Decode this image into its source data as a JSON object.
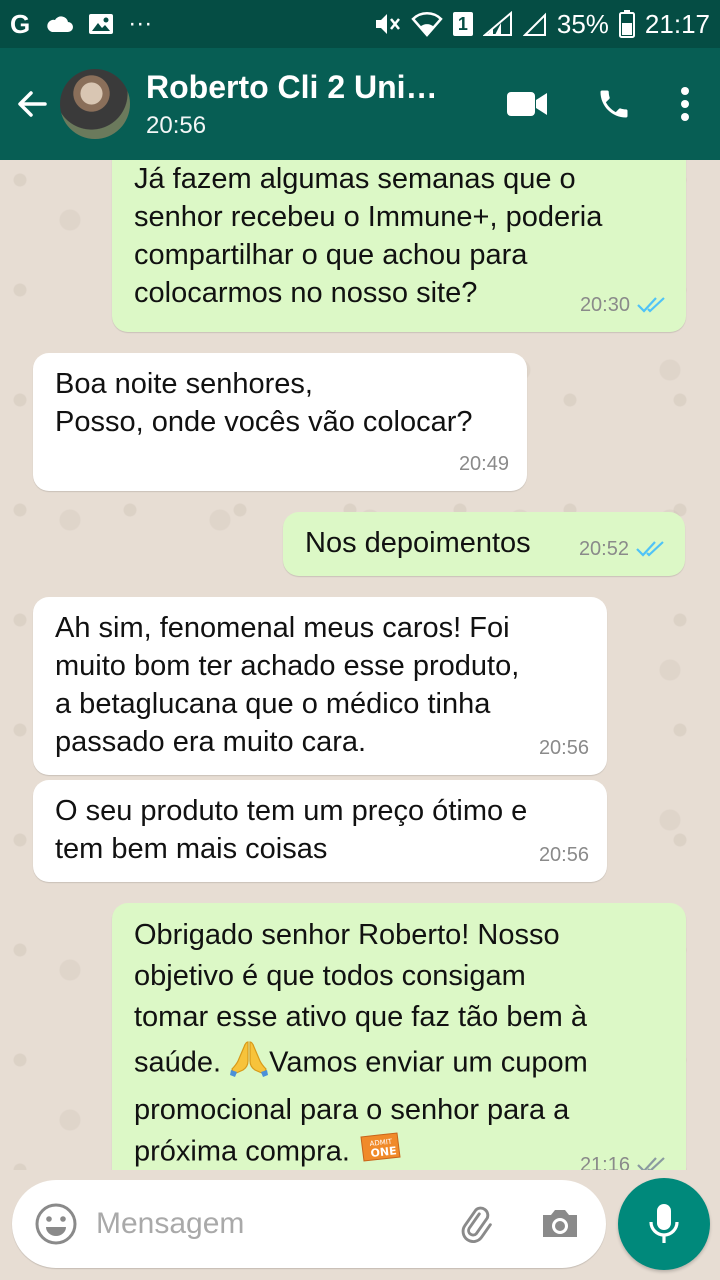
{
  "status_bar": {
    "carrier_glyph": "G",
    "battery": "35%",
    "time": "21:17",
    "sim_badge": "1",
    "dots": "···"
  },
  "header": {
    "title": "Roberto Cli 2 Uni…",
    "subtitle": "20:56"
  },
  "messages": [
    {
      "id": "m1",
      "direction": "out",
      "text": "Já fazem algumas semanas que o\nsenhor recebeu o Immune+, poderia\ncompartilhar o que achou para\ncolocarmos no nosso site?",
      "time": "20:30",
      "status": "read"
    },
    {
      "id": "m2",
      "direction": "in",
      "text": "Boa noite senhores,\nPosso, onde vocês vão colocar?",
      "time": "20:49"
    },
    {
      "id": "m3",
      "direction": "out",
      "text": "Nos depoimentos",
      "time": "20:52",
      "status": "read"
    },
    {
      "id": "m4",
      "direction": "in",
      "text": "Ah sim, fenomenal meus caros! Foi\nmuito bom ter achado esse produto,\na betaglucana que o médico tinha\npassado era muito cara.",
      "time": "20:56"
    },
    {
      "id": "m5",
      "direction": "in",
      "text": "O seu produto tem um preço ótimo e\ntem bem mais coisas",
      "time": "20:56"
    },
    {
      "id": "m6",
      "direction": "out",
      "text_parts": [
        "Obrigado senhor Roberto! Nosso\nobjetivo é que todos consigam\ntomar esse ativo que faz tão bem à\nsaúde. ",
        "Vamos enviar um cupom\npromocional para o senhor para a\npróxima compra. "
      ],
      "emojis": [
        "folded-hands",
        "admission-ticket"
      ],
      "ticket_text": [
        "ADMIT",
        "ONE"
      ],
      "time": "21:16",
      "status": "read"
    }
  ],
  "input": {
    "placeholder": "Mensagem"
  },
  "colors": {
    "header_bg": "#075e54",
    "status_bg": "#054d44",
    "out_bubble": "#dcf8c6",
    "in_bubble": "#ffffff",
    "read_ticks": "#4fc3f7",
    "mic_button": "#00897b"
  }
}
